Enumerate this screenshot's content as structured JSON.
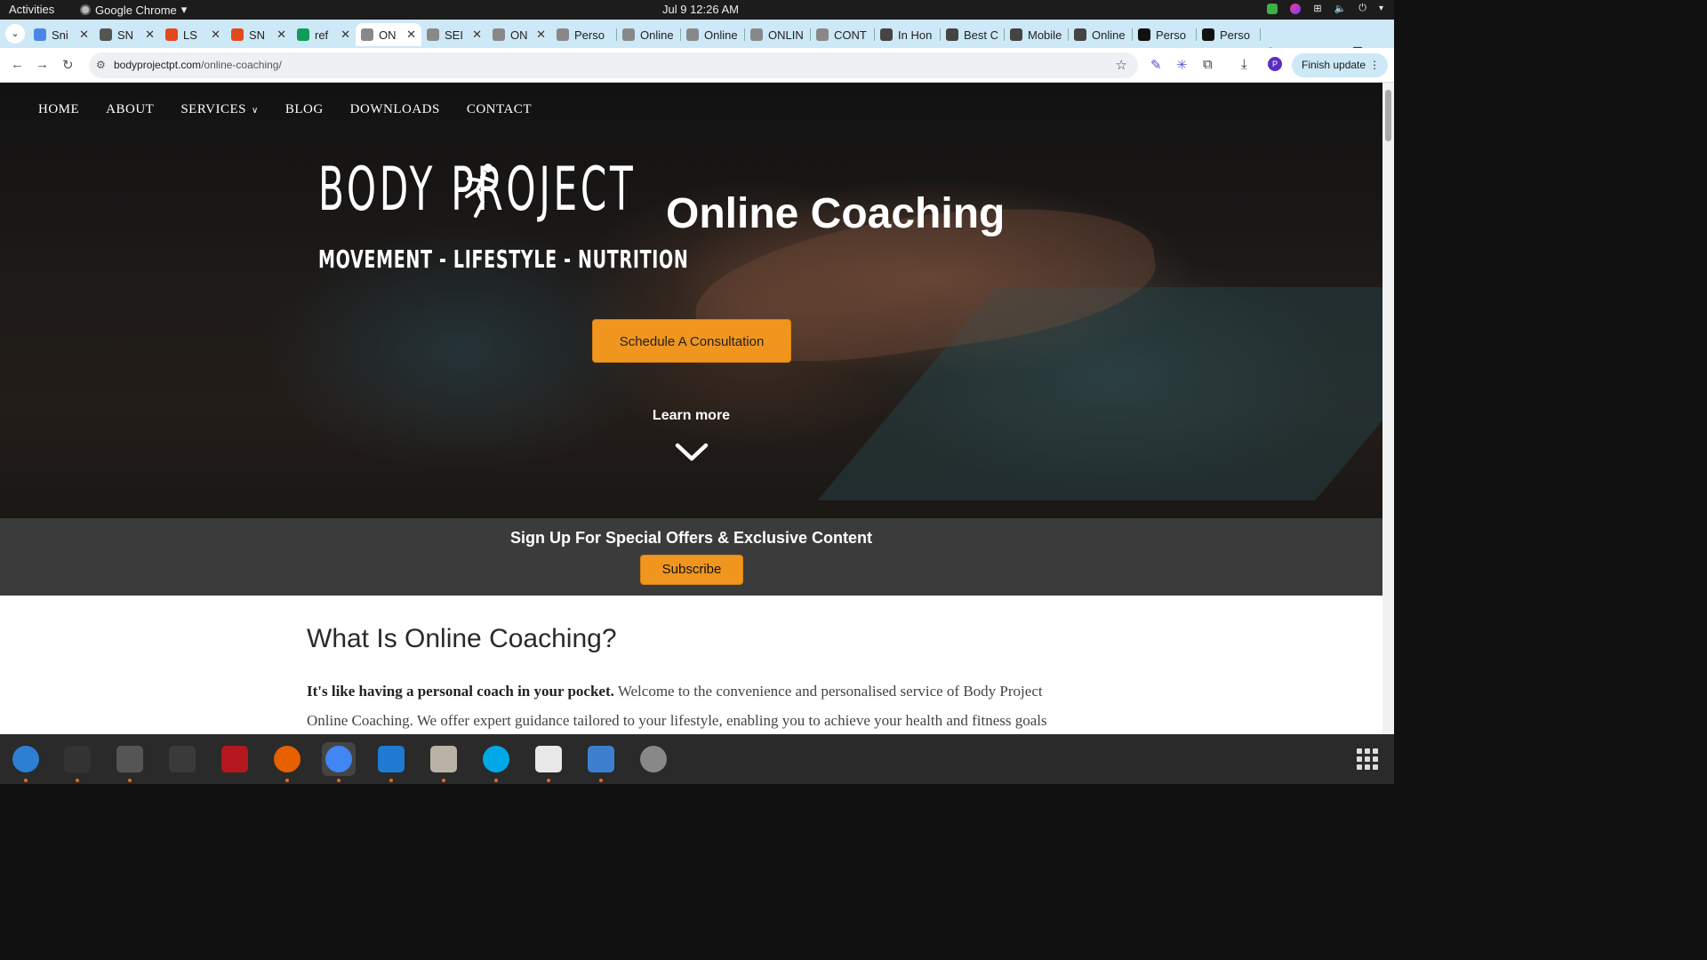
{
  "topbar": {
    "activities": "Activities",
    "app_name": "Google Chrome",
    "clock": "Jul 9  12:26 AM"
  },
  "tabs": [
    {
      "label": "Sni",
      "color": "#4a86e8"
    },
    {
      "label": "SN",
      "color": "#555555"
    },
    {
      "label": "LS",
      "color": "#e2491d"
    },
    {
      "label": "SN",
      "color": "#e2491d"
    },
    {
      "label": "ref",
      "color": "#0f9d58"
    },
    {
      "label": "ON",
      "color": "#888888"
    },
    {
      "label": "SEI",
      "color": "#888888"
    },
    {
      "label": "ON",
      "color": "#888888"
    },
    {
      "label": "Perso",
      "color": "#888888"
    },
    {
      "label": "Online",
      "color": "#888888"
    },
    {
      "label": "Online",
      "color": "#888888"
    },
    {
      "label": "ONLIN",
      "color": "#888888"
    },
    {
      "label": "CONT",
      "color": "#888888"
    },
    {
      "label": "In Hon",
      "color": "#444444"
    },
    {
      "label": "Best C",
      "color": "#444444"
    },
    {
      "label": "Mobile",
      "color": "#444444"
    },
    {
      "label": "Online",
      "color": "#444444"
    },
    {
      "label": "Perso",
      "color": "#111111"
    },
    {
      "label": "Perso",
      "color": "#111111"
    }
  ],
  "toolbar": {
    "url_domain": "bodyprojectpt.com",
    "url_path": "/online-coaching/",
    "profile_initial": "P",
    "finish_update": "Finish update"
  },
  "site": {
    "nav": [
      "HOME",
      "ABOUT",
      "SERVICES",
      "BLOG",
      "DOWNLOADS",
      "CONTACT"
    ],
    "logo_text": "BODY PROJECT",
    "tagline": "MOVEMENT - LIFESTYLE - NUTRITION",
    "hero_title": "Online Coaching",
    "cta": "Schedule A Consultation",
    "learn_more": "Learn more",
    "signup_heading": "Sign Up For Special Offers & Exclusive Content",
    "subscribe": "Subscribe",
    "section_title": "What Is Online Coaching?",
    "intro_bold": "It's like having a personal coach in your pocket.",
    "intro_text": " Welcome to the convenience and personalised service of Body Project Online Coaching. We offer expert guidance tailored to your lifestyle, enabling you to achieve your health and fitness goals"
  },
  "dock": [
    {
      "name": "thunderbird",
      "color": "#2d7fd3"
    },
    {
      "name": "terminal",
      "color": "#333333"
    },
    {
      "name": "calculator",
      "color": "#555555"
    },
    {
      "name": "system-monitor",
      "color": "#3a3a3a"
    },
    {
      "name": "filezilla",
      "color": "#b5171e"
    },
    {
      "name": "firefox",
      "color": "#e66000"
    },
    {
      "name": "chrome",
      "color": "#4285f4"
    },
    {
      "name": "vscode",
      "color": "#1f7ad1"
    },
    {
      "name": "files",
      "color": "#b9b3a5"
    },
    {
      "name": "skype",
      "color": "#00a8e8"
    },
    {
      "name": "text-editor",
      "color": "#e8e8e8"
    },
    {
      "name": "document-viewer",
      "color": "#3d7fcf"
    },
    {
      "name": "disks",
      "color": "#888888"
    }
  ]
}
